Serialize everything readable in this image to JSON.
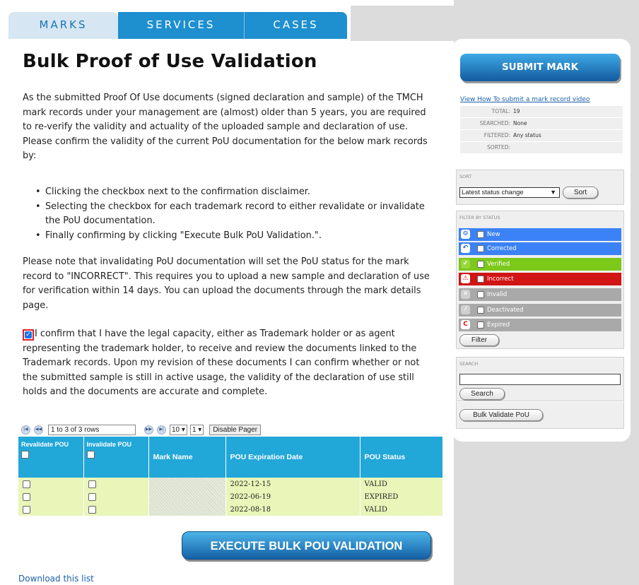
{
  "tabs": [
    {
      "label": "MARKS"
    },
    {
      "label": "SERVICES"
    },
    {
      "label": "CASES"
    }
  ],
  "page": {
    "title": "Bulk Proof of Use Validation",
    "intro": "As the submitted Proof Of Use documents (signed declaration and sample) of the TMCH mark records under your management are (almost) older than 5 years, you are required to re-verify the validity and actuality of the uploaded sample and declaration of use.",
    "instruction": "Please confirm the validity of the current PoU documentation for the below mark records by:",
    "steps": [
      "Clicking the checkbox next to the confirmation disclaimer.",
      "Selecting the checkbox for each trademark record to either revalidate or invalidate the PoU documentation.",
      "Finally confirming by clicking \"Execute Bulk PoU Validation.\"."
    ],
    "note": "Please note that invalidating PoU documentation will set the PoU status for the mark record to \"INCORRECT\". This requires you to upload a new sample and declaration of use for verification within 14 days. You can upload the documents through the mark details page.",
    "disclaimer": "I confirm that I have the legal capacity, either as Trademark holder or as agent representing the trademark holder, to receive and review the documents linked to the Trademark records. Upon my revision of these documents I can confirm whether or not the submitted sample is still in active usage, the validity of the declaration of use still holds and the documents are accurate and complete.",
    "disclaimer_checked": true,
    "execute_label": "EXECUTE BULK POU VALIDATION",
    "download_label": "Download this list"
  },
  "pager": {
    "range": "1 to 3 of 3 rows",
    "page_size": "10",
    "page": "1",
    "disable_label": "Disable Pager",
    "first_icon": "first-page-icon",
    "prev_icon": "prev-page-icon",
    "next_icon": "next-page-icon",
    "last_icon": "last-page-icon"
  },
  "table": {
    "columns": [
      "Revalidate POU",
      "Invalidate POU",
      "Mark Name",
      "POU Expiration Date",
      "POU Status"
    ],
    "rows": [
      {
        "mark_name": "",
        "expiration": "2022-12-15",
        "status": "VALID"
      },
      {
        "mark_name": "",
        "expiration": "2022-06-19",
        "status": "EXPIRED"
      },
      {
        "mark_name": "",
        "expiration": "2022-08-18",
        "status": "VALID"
      }
    ]
  },
  "sidebar": {
    "submit_label": "SUBMIT MARK",
    "video_link": "View How To submit a mark record video",
    "stats": [
      {
        "key": "TOTAL:",
        "value": "19"
      },
      {
        "key": "SEARCHED:",
        "value": "None"
      },
      {
        "key": "FILTERED:",
        "value": "Any status"
      },
      {
        "key": "SORTED:",
        "value": ""
      }
    ],
    "sort": {
      "title": "SORT",
      "selected": "Latest status change",
      "button": "Sort"
    },
    "filter": {
      "title": "FILTER BY STATUS",
      "statuses": [
        {
          "label": "New",
          "color": "#3b82f6",
          "icon": "gear-icon"
        },
        {
          "label": "Corrected",
          "color": "#3b82f6",
          "icon": "undo-icon"
        },
        {
          "label": "Verified",
          "color": "#7cc91a",
          "icon": "check-icon"
        },
        {
          "label": "Incorrect",
          "color": "#d11414",
          "icon": "warning-icon"
        },
        {
          "label": "Invalid",
          "color": "#a9a9a9",
          "icon": "cross-icon"
        },
        {
          "label": "Deactivated",
          "color": "#a9a9a9",
          "icon": "slash-icon"
        },
        {
          "label": "Expired",
          "color": "#a9a9a9",
          "icon": "expired-icon"
        }
      ],
      "button": "Filter"
    },
    "search": {
      "title": "SEARCH",
      "value": "",
      "button": "Search"
    },
    "bulk_label": "Bulk Validate PoU"
  }
}
